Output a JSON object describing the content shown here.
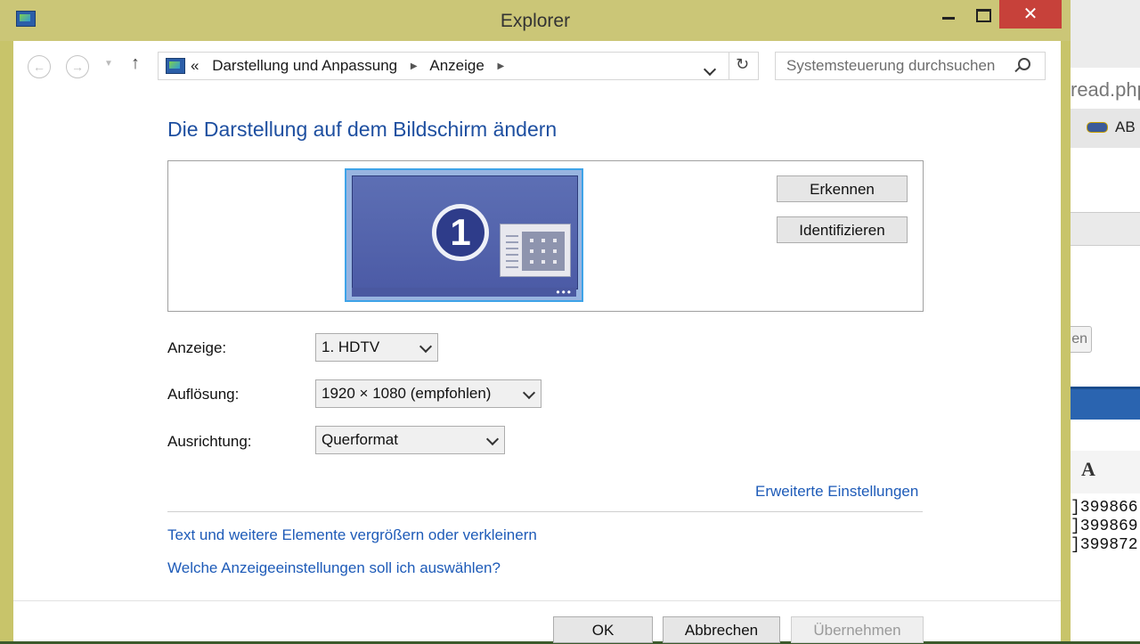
{
  "window": {
    "title": "Explorer",
    "close_glyph": "✕",
    "frame_color": "#cbc677",
    "close_color": "#c7413a"
  },
  "nav": {
    "back_glyph": "←",
    "forward_glyph": "→",
    "recent_glyph": "▼",
    "up_glyph": "↑",
    "breadcrumb": {
      "overflow": "«",
      "items": [
        "Darstellung und Anpassung",
        "Anzeige"
      ],
      "separator": "▶"
    },
    "refresh_glyph": "↻",
    "search_placeholder": "Systemsteuerung durchsuchen"
  },
  "main": {
    "title": "Die Darstellung auf dem Bildschirm ändern",
    "monitor_number": "1",
    "detect_button": "Erkennen",
    "identify_button": "Identifizieren",
    "display_label": "Anzeige:",
    "display_value": "1. HDTV",
    "resolution_label": "Auflösung:",
    "resolution_value": "1920 × 1080 (empfohlen)",
    "orientation_label": "Ausrichtung:",
    "orientation_value": "Querformat",
    "advanced_link": "Erweiterte Einstellungen",
    "textsize_link": "Text und weitere Elemente vergrößern oder verkleinern",
    "which_settings_link": "Welche Anzeigeeinstellungen soll ich auswählen?",
    "link_color": "#1e5bb8",
    "title_color": "#1e4fa0"
  },
  "footer": {
    "ok": "OK",
    "cancel": "Abbrechen",
    "apply": "Übernehmen"
  },
  "background_window": {
    "url_fragment": "read.php",
    "toolbar_item": "AB",
    "button_fragment": "en",
    "font_button": "A",
    "numbers": [
      "]399866",
      "]399869",
      "]399872"
    ]
  }
}
